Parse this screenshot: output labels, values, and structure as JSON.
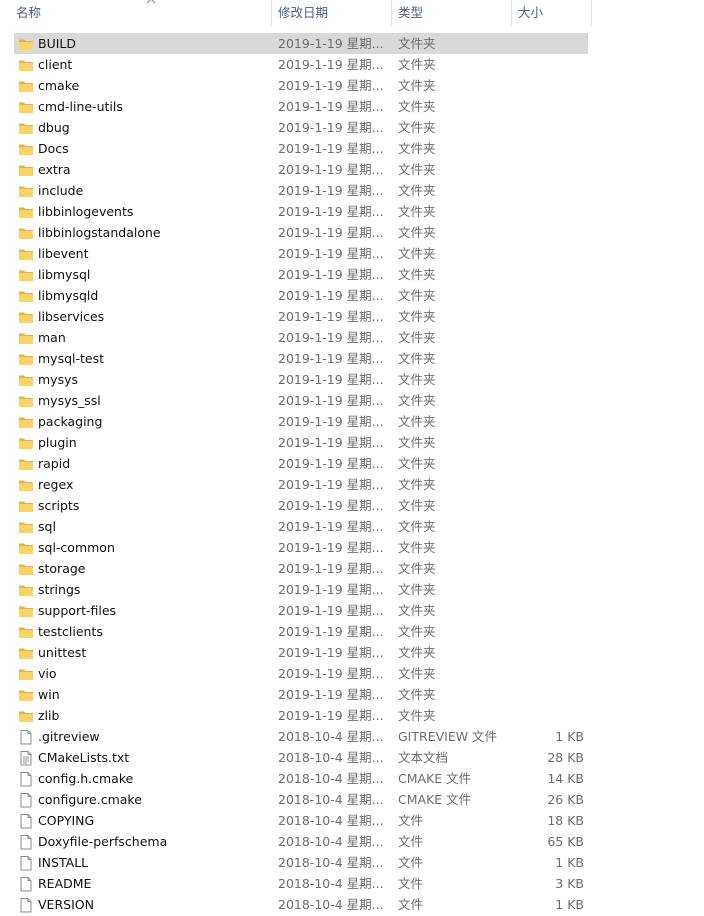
{
  "columns": {
    "name": "名称",
    "date": "修改日期",
    "type": "类型",
    "size": "大小"
  },
  "colors": {
    "folder": "#f6d36b",
    "folder_dark": "#e3b341",
    "selected_row": "#d9d9d9",
    "header_text": "#4d6082"
  },
  "files": [
    {
      "name": "BUILD",
      "date": "2019-1-19 星期...",
      "type": "文件夹",
      "size": "",
      "icon": "folder-icon",
      "selected": true
    },
    {
      "name": "client",
      "date": "2019-1-19 星期...",
      "type": "文件夹",
      "size": "",
      "icon": "folder-icon"
    },
    {
      "name": "cmake",
      "date": "2019-1-19 星期...",
      "type": "文件夹",
      "size": "",
      "icon": "folder-icon"
    },
    {
      "name": "cmd-line-utils",
      "date": "2019-1-19 星期...",
      "type": "文件夹",
      "size": "",
      "icon": "folder-icon"
    },
    {
      "name": "dbug",
      "date": "2019-1-19 星期...",
      "type": "文件夹",
      "size": "",
      "icon": "folder-icon"
    },
    {
      "name": "Docs",
      "date": "2019-1-19 星期...",
      "type": "文件夹",
      "size": "",
      "icon": "folder-icon"
    },
    {
      "name": "extra",
      "date": "2019-1-19 星期...",
      "type": "文件夹",
      "size": "",
      "icon": "folder-icon"
    },
    {
      "name": "include",
      "date": "2019-1-19 星期...",
      "type": "文件夹",
      "size": "",
      "icon": "folder-icon"
    },
    {
      "name": "libbinlogevents",
      "date": "2019-1-19 星期...",
      "type": "文件夹",
      "size": "",
      "icon": "folder-icon"
    },
    {
      "name": "libbinlogstandalone",
      "date": "2019-1-19 星期...",
      "type": "文件夹",
      "size": "",
      "icon": "folder-icon"
    },
    {
      "name": "libevent",
      "date": "2019-1-19 星期...",
      "type": "文件夹",
      "size": "",
      "icon": "folder-icon"
    },
    {
      "name": "libmysql",
      "date": "2019-1-19 星期...",
      "type": "文件夹",
      "size": "",
      "icon": "folder-icon"
    },
    {
      "name": "libmysqld",
      "date": "2019-1-19 星期...",
      "type": "文件夹",
      "size": "",
      "icon": "folder-icon"
    },
    {
      "name": "libservices",
      "date": "2019-1-19 星期...",
      "type": "文件夹",
      "size": "",
      "icon": "folder-icon"
    },
    {
      "name": "man",
      "date": "2019-1-19 星期...",
      "type": "文件夹",
      "size": "",
      "icon": "folder-icon"
    },
    {
      "name": "mysql-test",
      "date": "2019-1-19 星期...",
      "type": "文件夹",
      "size": "",
      "icon": "folder-icon"
    },
    {
      "name": "mysys",
      "date": "2019-1-19 星期...",
      "type": "文件夹",
      "size": "",
      "icon": "folder-icon"
    },
    {
      "name": "mysys_ssl",
      "date": "2019-1-19 星期...",
      "type": "文件夹",
      "size": "",
      "icon": "folder-icon"
    },
    {
      "name": "packaging",
      "date": "2019-1-19 星期...",
      "type": "文件夹",
      "size": "",
      "icon": "folder-icon"
    },
    {
      "name": "plugin",
      "date": "2019-1-19 星期...",
      "type": "文件夹",
      "size": "",
      "icon": "folder-icon"
    },
    {
      "name": "rapid",
      "date": "2019-1-19 星期...",
      "type": "文件夹",
      "size": "",
      "icon": "folder-icon"
    },
    {
      "name": "regex",
      "date": "2019-1-19 星期...",
      "type": "文件夹",
      "size": "",
      "icon": "folder-icon"
    },
    {
      "name": "scripts",
      "date": "2019-1-19 星期...",
      "type": "文件夹",
      "size": "",
      "icon": "folder-icon"
    },
    {
      "name": "sql",
      "date": "2019-1-19 星期...",
      "type": "文件夹",
      "size": "",
      "icon": "folder-icon"
    },
    {
      "name": "sql-common",
      "date": "2019-1-19 星期...",
      "type": "文件夹",
      "size": "",
      "icon": "folder-icon"
    },
    {
      "name": "storage",
      "date": "2019-1-19 星期...",
      "type": "文件夹",
      "size": "",
      "icon": "folder-icon"
    },
    {
      "name": "strings",
      "date": "2019-1-19 星期...",
      "type": "文件夹",
      "size": "",
      "icon": "folder-icon"
    },
    {
      "name": "support-files",
      "date": "2019-1-19 星期...",
      "type": "文件夹",
      "size": "",
      "icon": "folder-icon"
    },
    {
      "name": "testclients",
      "date": "2019-1-19 星期...",
      "type": "文件夹",
      "size": "",
      "icon": "folder-icon"
    },
    {
      "name": "unittest",
      "date": "2019-1-19 星期...",
      "type": "文件夹",
      "size": "",
      "icon": "folder-icon"
    },
    {
      "name": "vio",
      "date": "2019-1-19 星期...",
      "type": "文件夹",
      "size": "",
      "icon": "folder-icon"
    },
    {
      "name": "win",
      "date": "2019-1-19 星期...",
      "type": "文件夹",
      "size": "",
      "icon": "folder-icon"
    },
    {
      "name": "zlib",
      "date": "2019-1-19 星期...",
      "type": "文件夹",
      "size": "",
      "icon": "folder-icon"
    },
    {
      "name": ".gitreview",
      "date": "2018-10-4 星期...",
      "type": "GITREVIEW 文件",
      "size": "1 KB",
      "icon": "file-icon"
    },
    {
      "name": "CMakeLists.txt",
      "date": "2018-10-4 星期...",
      "type": "文本文档",
      "size": "28 KB",
      "icon": "text-file-icon"
    },
    {
      "name": "config.h.cmake",
      "date": "2018-10-4 星期...",
      "type": "CMAKE 文件",
      "size": "14 KB",
      "icon": "file-icon"
    },
    {
      "name": "configure.cmake",
      "date": "2018-10-4 星期...",
      "type": "CMAKE 文件",
      "size": "26 KB",
      "icon": "file-icon"
    },
    {
      "name": "COPYING",
      "date": "2018-10-4 星期...",
      "type": "文件",
      "size": "18 KB",
      "icon": "file-icon"
    },
    {
      "name": "Doxyfile-perfschema",
      "date": "2018-10-4 星期...",
      "type": "文件",
      "size": "65 KB",
      "icon": "file-icon"
    },
    {
      "name": "INSTALL",
      "date": "2018-10-4 星期...",
      "type": "文件",
      "size": "1 KB",
      "icon": "file-icon"
    },
    {
      "name": "README",
      "date": "2018-10-4 星期...",
      "type": "文件",
      "size": "3 KB",
      "icon": "file-icon"
    },
    {
      "name": "VERSION",
      "date": "2018-10-4 星期...",
      "type": "文件",
      "size": "1 KB",
      "icon": "file-icon"
    }
  ]
}
